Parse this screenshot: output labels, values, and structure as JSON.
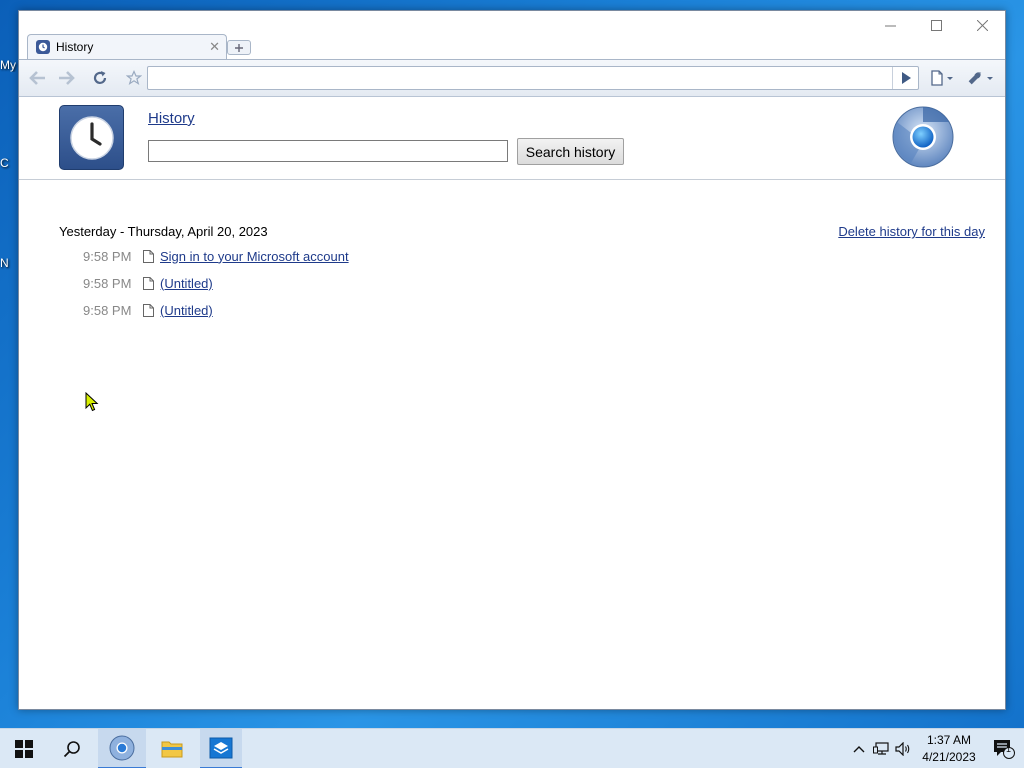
{
  "desktop": {
    "icon_labels": [
      "My",
      "C",
      "N"
    ]
  },
  "browser": {
    "tab": {
      "title": "History"
    },
    "toolbar": {
      "address_value": ""
    }
  },
  "page": {
    "title": "History",
    "search": {
      "value": "",
      "button_label": "Search history"
    },
    "day_heading": "Yesterday - Thursday, April 20, 2023",
    "delete_link": "Delete history for this day",
    "entries": [
      {
        "time": "9:58 PM",
        "title": "Sign in to your Microsoft account"
      },
      {
        "time": "9:58 PM",
        "title": "(Untitled)"
      },
      {
        "time": "9:58 PM",
        "title": "(Untitled)"
      }
    ]
  },
  "taskbar": {
    "clock": {
      "time": "1:37 AM",
      "date": "4/21/2023"
    },
    "notification_count": "1"
  },
  "colors": {
    "link": "#1e3a8a",
    "accent": "#3a7bd5"
  }
}
